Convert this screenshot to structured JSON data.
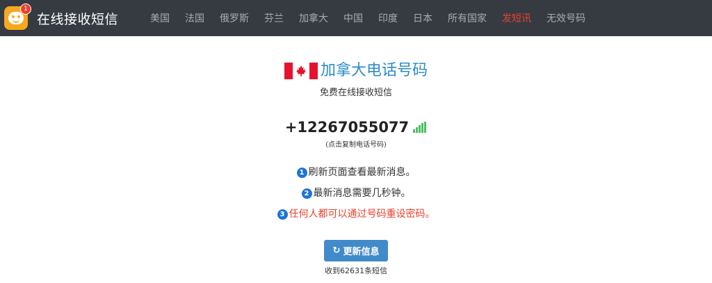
{
  "navbar": {
    "brand_title": "在线接收短信",
    "logo_badge": "1",
    "links": [
      "美国",
      "法国",
      "俄罗斯",
      "芬兰",
      "加拿大",
      "中国",
      "印度",
      "日本",
      "所有国家",
      "发短讯",
      "无效号码"
    ],
    "active_color": "#e8412c"
  },
  "main": {
    "title": "加拿大电话号码",
    "subtitle": "免费在线接收短信",
    "phone_number": "+12267055077",
    "copy_hint": "(点击复制电话号码)",
    "tips": [
      {
        "num": "1",
        "text": "刷新页面查看最新消息。"
      },
      {
        "num": "2",
        "text": "最新消息需要几秒钟。"
      },
      {
        "num": "3",
        "text": "任何人都可以通过号码重设密码。"
      }
    ],
    "refresh_label": "更新信息",
    "received_count": "收到62631条短信"
  },
  "colors": {
    "navbar_bg": "#363b42",
    "title_blue": "#2e8bc9",
    "button_blue": "#428bca",
    "warning_red": "#e8412c",
    "signal_green": "#48c15e"
  },
  "icons": {
    "flag": "canada-flag-icon",
    "signal": "signal-strength-icon",
    "refresh": "refresh-icon"
  }
}
